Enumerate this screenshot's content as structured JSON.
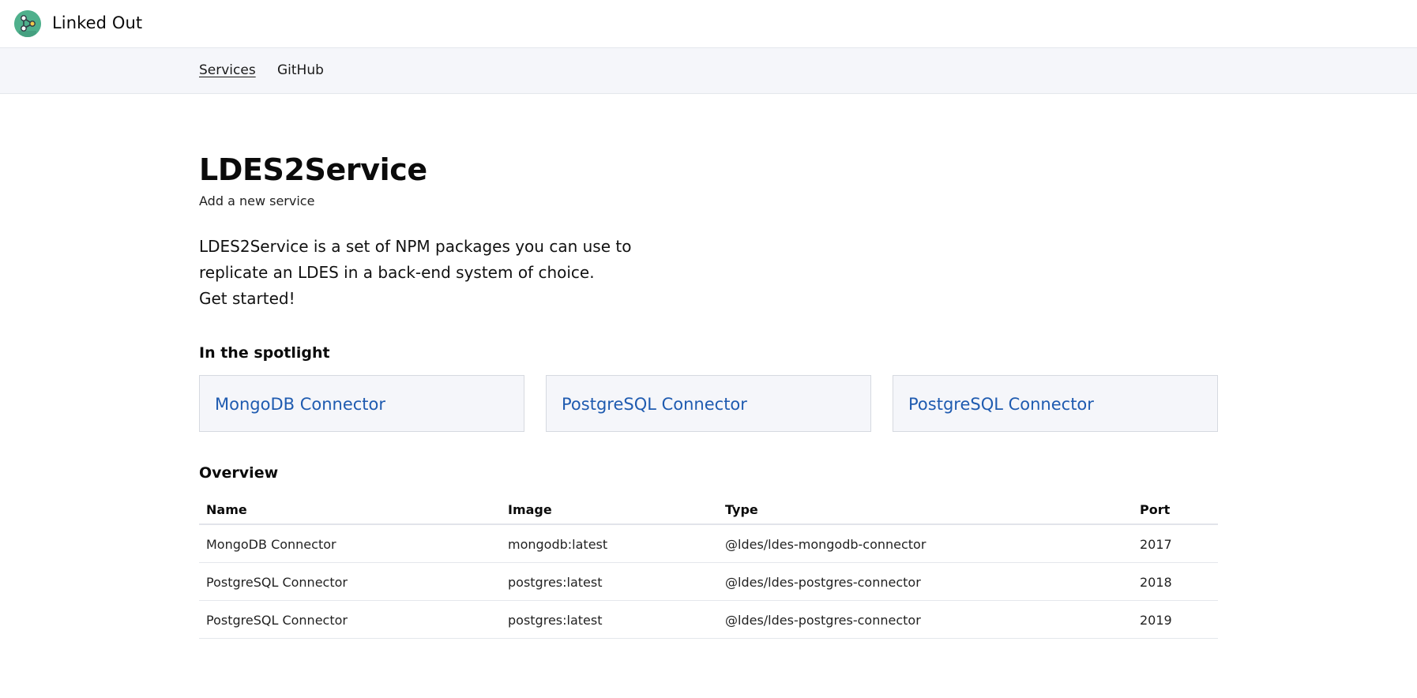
{
  "header": {
    "app_name": "Linked Out",
    "logo_icon": "network-graph-logo-icon"
  },
  "nav": {
    "items": [
      {
        "label": "Services",
        "active": true
      },
      {
        "label": "GitHub",
        "active": false
      }
    ]
  },
  "main": {
    "title": "LDES2Service",
    "subtitle": "Add a new service",
    "intro_lines": [
      "LDES2Service is a set of NPM packages you can use to",
      "replicate an LDES in a back-end system of choice.",
      "Get started!"
    ],
    "spotlight": {
      "heading": "In the spotlight",
      "cards": [
        {
          "label": "MongoDB Connector"
        },
        {
          "label": "PostgreSQL Connector"
        },
        {
          "label": "PostgreSQL Connector"
        }
      ]
    },
    "overview": {
      "heading": "Overview",
      "columns": [
        "Name",
        "Image",
        "Type",
        "Port"
      ],
      "rows": [
        [
          "MongoDB Connector",
          "mongodb:latest",
          "@ldes/ldes-mongodb-connector",
          "2017"
        ],
        [
          "PostgreSQL Connector",
          "postgres:latest",
          "@ldes/ldes-postgres-connector",
          "2018"
        ],
        [
          "PostgreSQL Connector",
          "postgres:latest",
          "@ldes/ldes-postgres-connector",
          "2019"
        ]
      ]
    }
  },
  "colors": {
    "link": "#1f5bb0",
    "logo_bg": "#4fb08c",
    "nav_bg": "#f5f6fa",
    "card_bg": "#f5f6fa"
  }
}
